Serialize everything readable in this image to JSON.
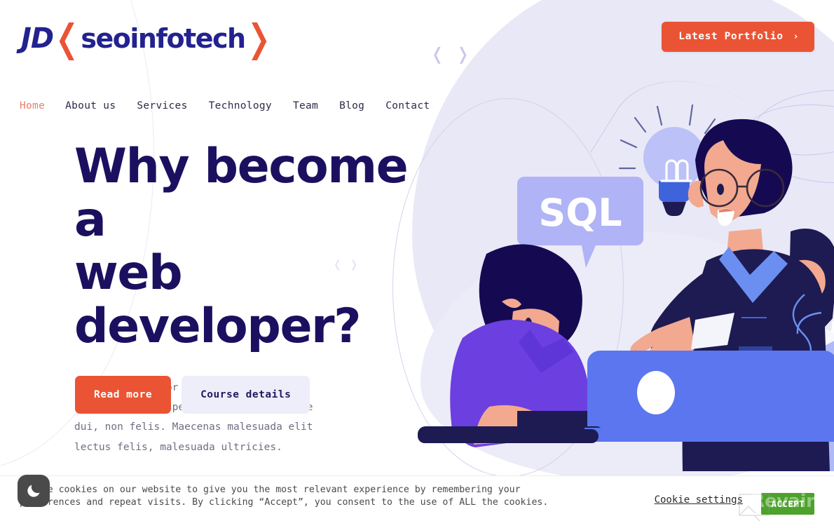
{
  "brand": {
    "prefix": "JD",
    "bracket_open": "❬",
    "name": "seoinfotech",
    "bracket_close": "❭",
    "color_text": "#23228f",
    "color_bracket": "#ea5434"
  },
  "header": {
    "portfolio_button": {
      "label": "Latest Portfolio",
      "chevron": "›",
      "bg": "#ea5434",
      "fg": "#ffffff"
    }
  },
  "nav": {
    "items": [
      {
        "label": "Home",
        "active": true
      },
      {
        "label": "About us",
        "active": false
      },
      {
        "label": "Services",
        "active": false
      },
      {
        "label": "Technology",
        "active": false
      },
      {
        "label": "Team",
        "active": false
      },
      {
        "label": "Blog",
        "active": false
      },
      {
        "label": "Contact",
        "active": false
      }
    ],
    "active_color": "#e9806b",
    "idle_color": "#2b2b4a"
  },
  "hero": {
    "heading_line1": "Why become a",
    "heading_line2": "web developer?",
    "heading_color": "#1b1060",
    "paragraph": "Lorem ipsum dolor sit amet enim. Etiam ullamcorper. Suspendisse a pellentesque dui, non felis. Maecenas malesuada elit lectus felis, malesuada ultricies.",
    "primary_button": {
      "label": "Read more",
      "bg": "#ea5434",
      "fg": "#ffffff"
    },
    "secondary_button": {
      "label": "Course details",
      "bg": "#eeedfa",
      "fg": "#221a5e"
    }
  },
  "decor": {
    "bracket_large": "❬ ❭",
    "bracket_small": "❬ ❭",
    "blob_color": "#e9e8f7",
    "line_color": "#c9c8ea"
  },
  "illustration": {
    "speech_bubble_label": "SQL",
    "bubble_bg": "#b0b3f5",
    "bubble_text_color": "#ffffff",
    "bulb_color": "#bcc2f7",
    "hair_color": "#150a52",
    "skin_color": "#f2a98f",
    "shirt_purple": "#6c3fe0",
    "shirt_navy": "#1d1b52",
    "laptop_color": "#5b76ef",
    "desk_color": "#1d1b52"
  },
  "cookie": {
    "text": "We use cookies on our website to give you the most relevant experience by remembering your preferences and repeat visits. By clicking “Accept”, you consent to the use of ALL the cookies.",
    "settings_label": "Cookie settings",
    "accept_label": "ACCEPT",
    "accept_bg": "#4ca22a"
  },
  "widgets": {
    "dark_mode_toggle_icon": "moon-icon",
    "dark_mode_bg": "#4a4a4a"
  },
  "watermark": {
    "text": "Revain"
  }
}
